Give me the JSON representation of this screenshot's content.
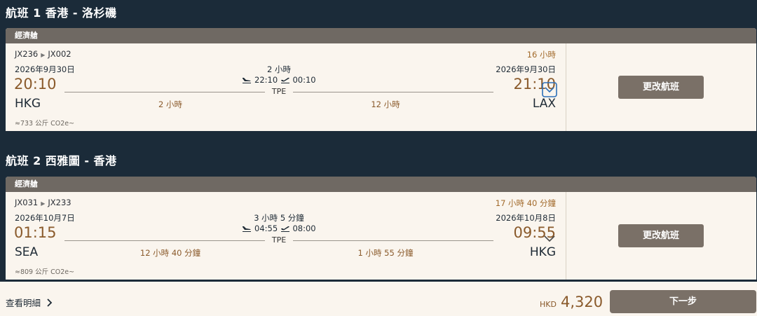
{
  "flights": [
    {
      "title": "航班 1 香港 - 洛杉磯",
      "cabin": "經濟艙",
      "route_first": "JX236",
      "route_second": "JX002",
      "total_duration": "16 小時",
      "depart_date": "2026年9月30日",
      "arrive_date": "2026年9月30日",
      "stop_duration": "2 小時",
      "stop_arrive": "22:10",
      "stop_depart": "00:10",
      "depart_time": "20:10",
      "arrive_time": "21:10",
      "stop_code": "TPE",
      "depart_code": "HKG",
      "arrive_code": "LAX",
      "leg1_duration": "2 小時",
      "leg2_duration": "12 小時",
      "co2": "≈733 公斤 CO2e~",
      "change_label": "更改航班",
      "expanded": true
    },
    {
      "title": "航班 2 西雅圖 - 香港",
      "cabin": "經濟艙",
      "route_first": "JX031",
      "route_second": "JX233",
      "total_duration": "17 小時 40 分鐘",
      "depart_date": "2026年10月7日",
      "arrive_date": "2026年10月8日",
      "stop_duration": "3 小時 5 分鐘",
      "stop_arrive": "04:55",
      "stop_depart": "08:00",
      "depart_time": "01:15",
      "arrive_time": "09:55",
      "stop_code": "TPE",
      "depart_code": "SEA",
      "arrive_code": "HKG",
      "leg1_duration": "12 小時 40 分鐘",
      "leg2_duration": "1 小時 55 分鐘",
      "co2": "≈809 公斤 CO2e~",
      "change_label": "更改航班",
      "expanded": false
    }
  ],
  "footer": {
    "details_label": "查看明細",
    "currency": "HKD",
    "price": "4,320",
    "next_label": "下一步"
  },
  "colors": {
    "background": "#1b2b39",
    "card": "#faf5ee",
    "header": "#6f6963",
    "button": "#7a7067",
    "accent": "#8a5a2b",
    "link": "#2c6fb8"
  },
  "icons": {
    "landing": "plane-landing-icon",
    "takeoff": "plane-takeoff-icon",
    "expand": "chevron-down-icon",
    "details": "chevron-right-icon"
  }
}
